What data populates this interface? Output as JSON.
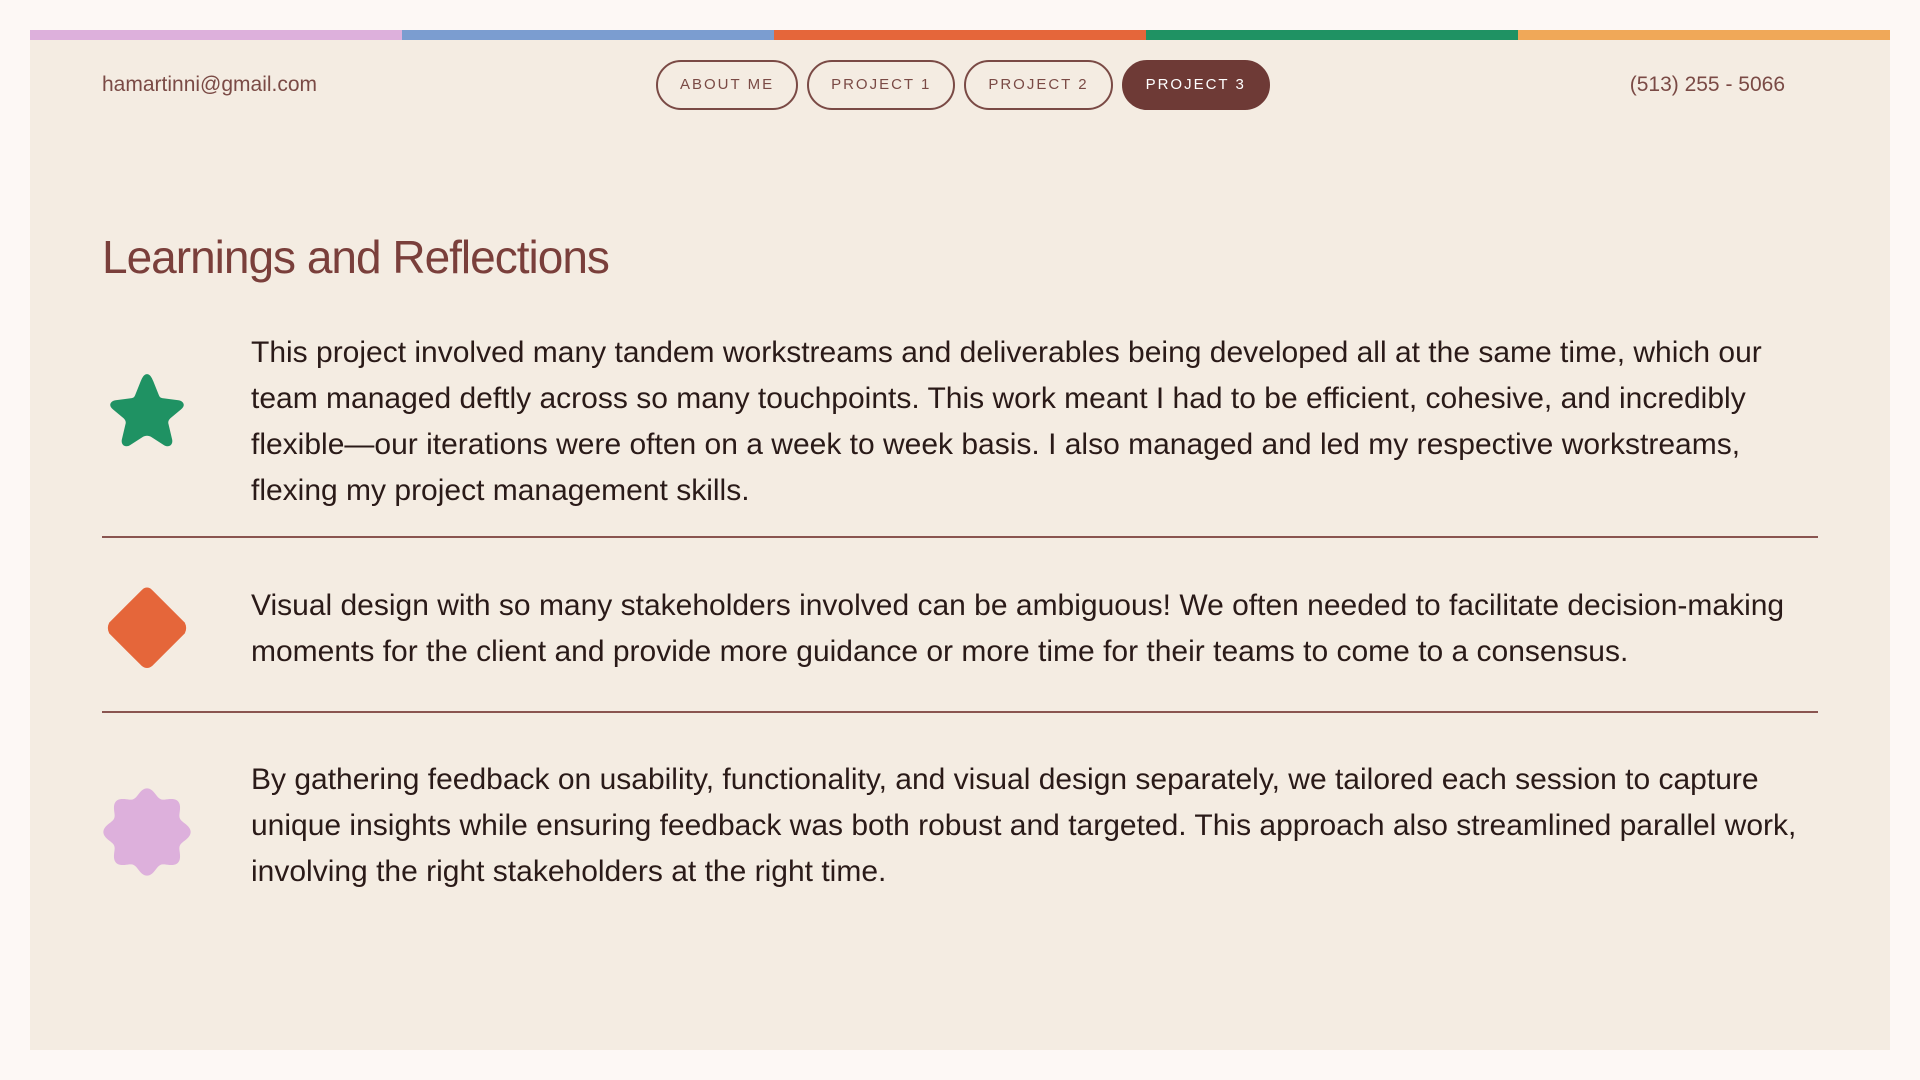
{
  "color_bar": [
    "#ddb0dc",
    "#7b9dd0",
    "#e5663a",
    "#1f9263",
    "#f0a858"
  ],
  "header": {
    "email": "hamartinni@gmail.com",
    "phone": "(513) 255 - 5066",
    "nav": [
      {
        "label": "ABOUT ME",
        "active": false
      },
      {
        "label": "PROJECT 1",
        "active": false
      },
      {
        "label": "PROJECT 2",
        "active": false
      },
      {
        "label": "PROJECT 3",
        "active": true
      }
    ]
  },
  "main": {
    "title": "Learnings and Reflections",
    "items": [
      {
        "icon": "star-icon",
        "icon_color": "#1f9263",
        "text": "This project involved many tandem workstreams and deliverables being developed all at the same time, which our team managed deftly across so many touchpoints. This work meant I had to be efficient, cohesive, and incredibly flexible—our iterations were often on a week to week basis. I also managed and led my respective workstreams, flexing my project management skills."
      },
      {
        "icon": "diamond-icon",
        "icon_color": "#e5663a",
        "text": "Visual design with so many stakeholders involved can be ambiguous! We often needed to facilitate decision-making moments for the client and provide more guidance or more time for their teams to come to a consensus."
      },
      {
        "icon": "flower-icon",
        "icon_color": "#ddb0dc",
        "text": "By gathering feedback on usability, functionality, and visual design separately, we tailored each session to capture unique insights while ensuring feedback was both robust and targeted. This approach also streamlined parallel work, involving the right stakeholders at the right time."
      }
    ]
  }
}
